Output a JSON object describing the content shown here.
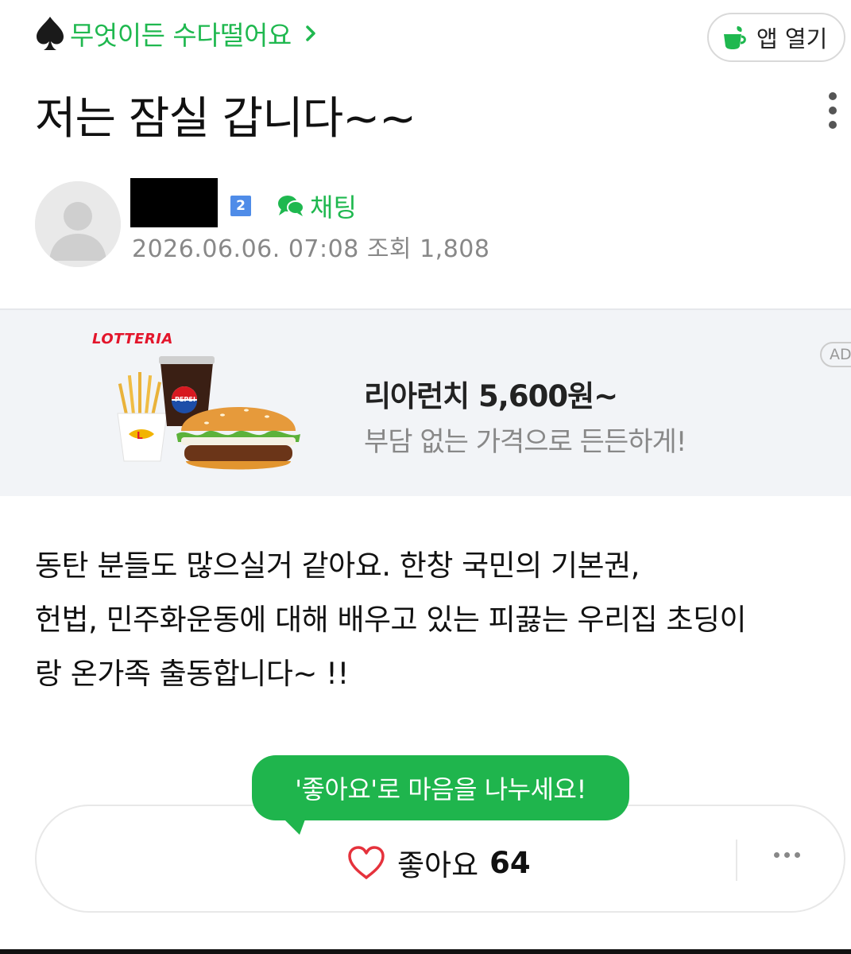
{
  "board": {
    "name": "무엇이든 수다떨어요"
  },
  "app_open": {
    "label": "앱 열기"
  },
  "post": {
    "title": "저는 잠실 갑니다~~",
    "author": {
      "level": "2",
      "chat_label": "채팅"
    },
    "meta": "2026.06.06. 07:08  조회 1,808",
    "body": [
      "동탄 분들도 많으실거 같아요. 한창 국민의 기본권,",
      "헌법, 민주화운동에 대해 배우고 있는 피끓는 우리집 초딩이",
      "랑 온가족 출동합니다~ !!"
    ]
  },
  "ad": {
    "brand": "LOTTERIA",
    "headline": "리아런치 5,600원~",
    "sub": "부담 없는 가격으로 든든하게!",
    "badge": "AD",
    "cup_label": "PEPSI"
  },
  "like": {
    "tooltip": "'좋아요'로 마음을 나누세요!",
    "label": "좋아요",
    "count": "64"
  },
  "colors": {
    "accent": "#1fb84f",
    "tooltip": "#1fb54d",
    "heart": "#e5323c"
  }
}
